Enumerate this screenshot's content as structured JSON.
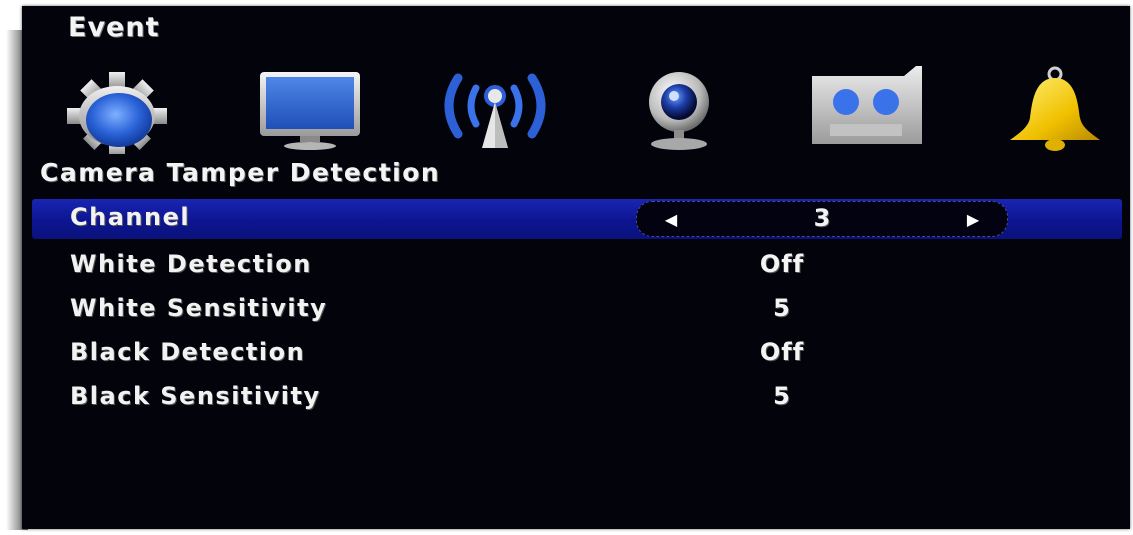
{
  "window": {
    "title": "Event"
  },
  "toolbar": {
    "icons": [
      {
        "name": "system-settings-icon"
      },
      {
        "name": "display-icon"
      },
      {
        "name": "network-icon"
      },
      {
        "name": "camera-icon"
      },
      {
        "name": "record-icon"
      },
      {
        "name": "event-bell-icon"
      }
    ],
    "active_index": 5
  },
  "section": {
    "title": "Camera Tamper Detection"
  },
  "rows": [
    {
      "label": "Channel",
      "value": "3"
    },
    {
      "label": "White Detection",
      "value": "Off"
    },
    {
      "label": "White Sensitivity",
      "value": "5"
    },
    {
      "label": "Black Detection",
      "value": "Off"
    },
    {
      "label": "Black Sensitivity",
      "value": "5"
    }
  ],
  "colors": {
    "background": "#02030b",
    "selection": "#0c1590",
    "text": "#f4f4f4"
  }
}
